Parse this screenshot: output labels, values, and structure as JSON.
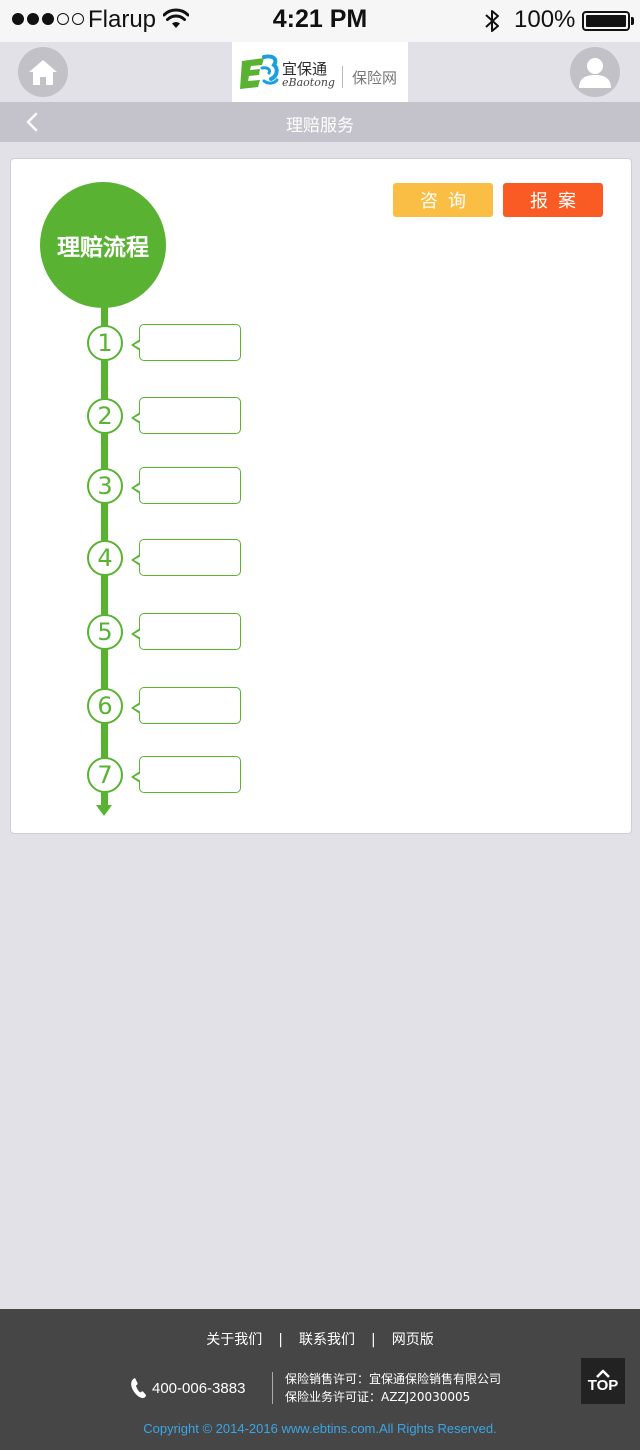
{
  "status_bar": {
    "carrier": "Flarup",
    "time": "4:21 PM",
    "battery": "100%",
    "battery_level": 1.0,
    "signal_bars_filled": 3,
    "signal_bars_total": 5
  },
  "header": {
    "logo_cn": "宜保通",
    "logo_en": "eBaotong",
    "site_label": "保险网",
    "home_icon": "home-icon",
    "user_icon": "user-icon"
  },
  "nav": {
    "title": "理赔服务",
    "back_icon": "chevron-left-icon"
  },
  "actions": {
    "consult_label": "咨询",
    "report_label": "报案",
    "consult_color": "#fbbe45",
    "report_color": "#fa5a23"
  },
  "process": {
    "title": "理赔流程",
    "accent_color": "#5ab233",
    "steps": [
      "1",
      "2",
      "3",
      "4",
      "5",
      "6",
      "7"
    ]
  },
  "footer": {
    "links": [
      "关于我们",
      "联系我们",
      "网页版"
    ],
    "separator": "|",
    "phone": "400-006-3883",
    "license_line1": "保险销售许可：宜保通保险销售有限公司",
    "license_line2": "保险业务许可证：AZZJ20030005",
    "top_label": "TOP",
    "copyright": "Copyright © 2014-2016 www.ebtins.com.All Rights Reserved."
  }
}
